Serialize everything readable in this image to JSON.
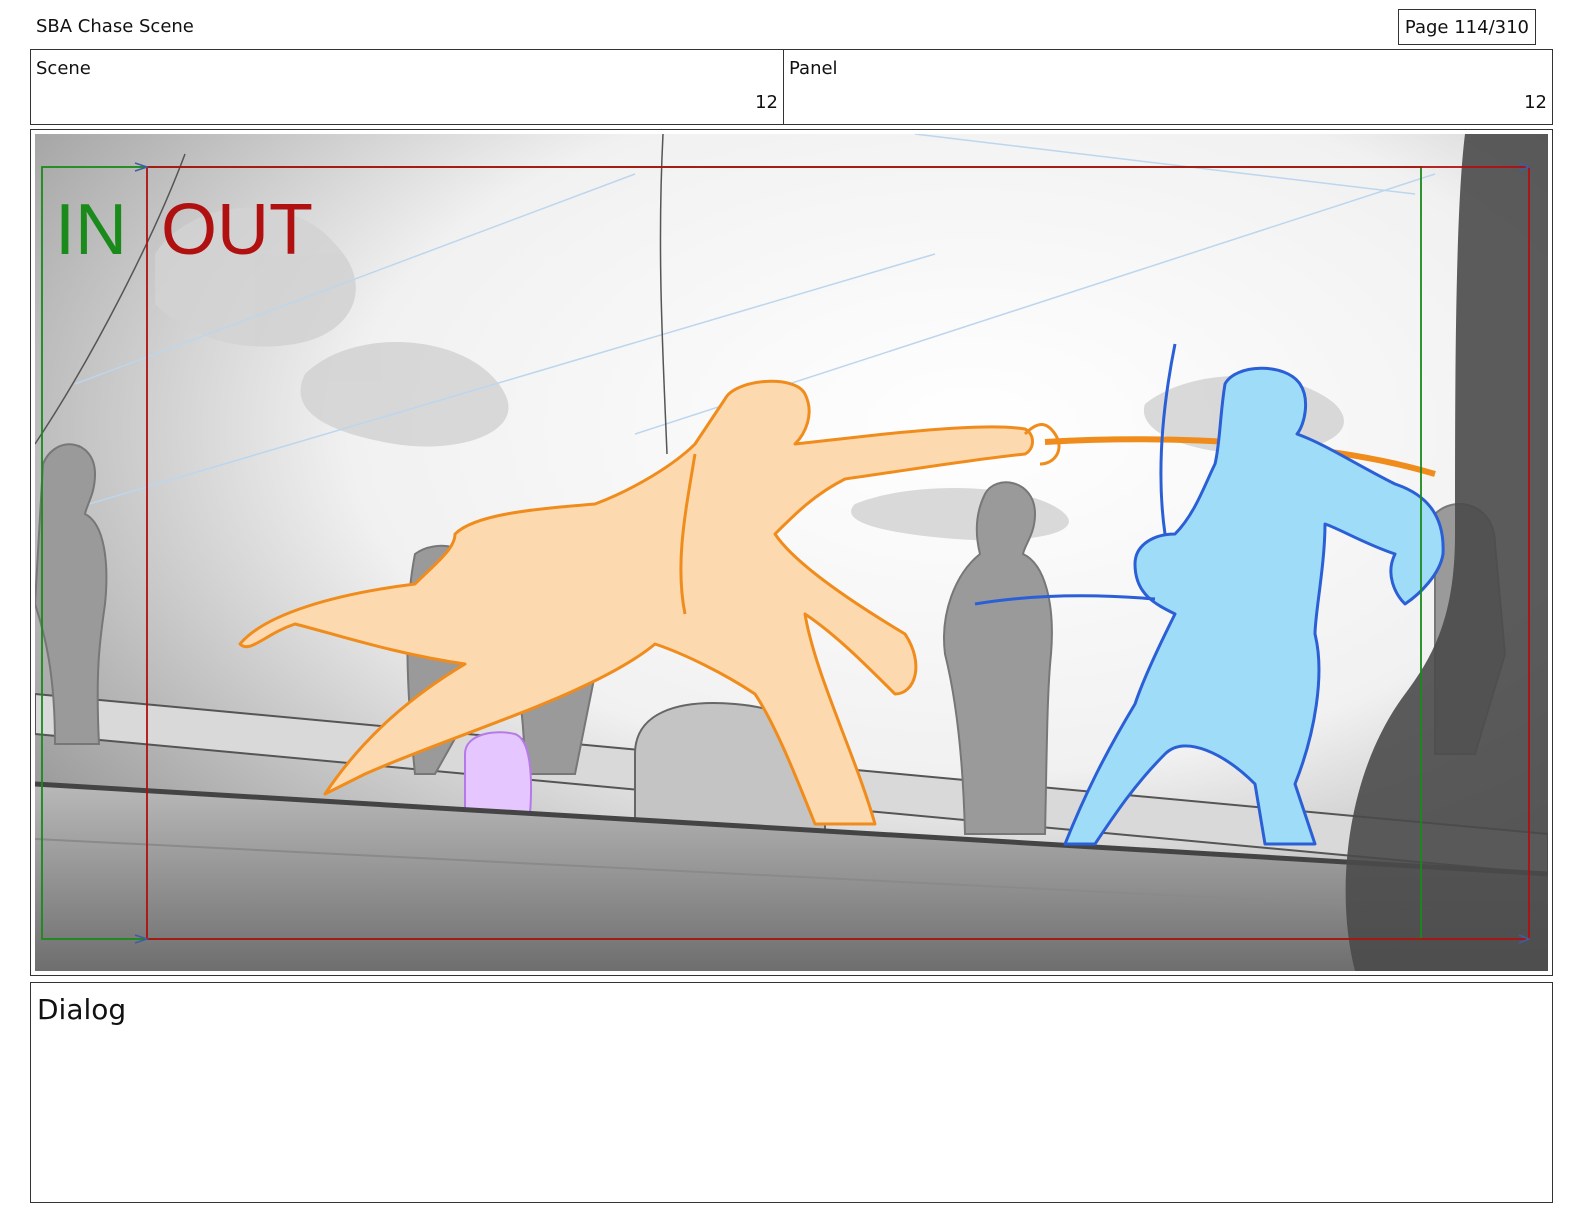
{
  "header": {
    "title": "SBA Chase Scene",
    "page": "Page 114/310"
  },
  "info": {
    "scene_label": "Scene",
    "scene_value": "12",
    "panel_label": "Panel",
    "panel_value": "12"
  },
  "panel": {
    "in_marker": "IN",
    "out_marker": "OUT",
    "colors": {
      "in_frame": "#1a8a1a",
      "out_frame": "#b01010",
      "character_a": "#f08c1c",
      "character_a_fill": "#fdd9b0",
      "character_b": "#2a5fd6",
      "character_b_fill": "#9fdcf8",
      "background_figures": "#8a8a8a",
      "accent_purple": "#c98af0"
    }
  },
  "dialog": {
    "label": "Dialog",
    "text": ""
  }
}
